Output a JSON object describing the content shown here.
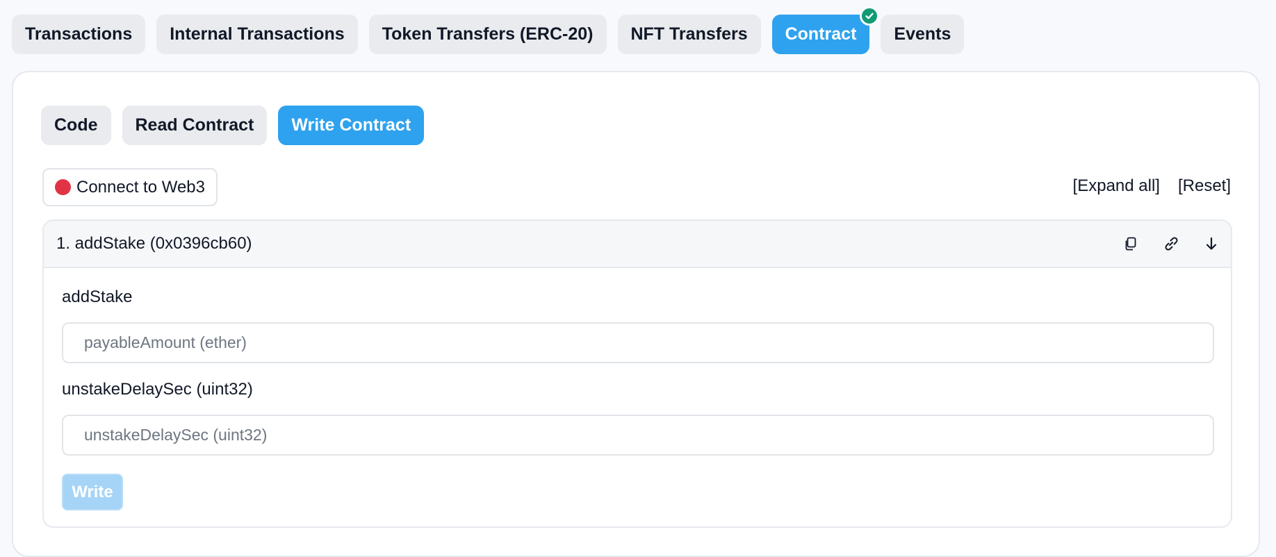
{
  "top_tabs": {
    "transactions": "Transactions",
    "internal": "Internal Transactions",
    "token_transfers": "Token Transfers (ERC-20)",
    "nft_transfers": "NFT Transfers",
    "contract": "Contract",
    "events": "Events"
  },
  "sub_tabs": {
    "code": "Code",
    "read": "Read Contract",
    "write": "Write Contract"
  },
  "connect": {
    "label": "Connect to Web3"
  },
  "actions": {
    "expand_all": "[Expand all]",
    "reset": "[Reset]"
  },
  "method": {
    "title": "1. addStake (0x0396cb60)",
    "field1_label": "addStake",
    "field1_placeholder": "payableAmount (ether)",
    "field2_label": "unstakeDelaySec (uint32)",
    "field2_placeholder": "unstakeDelaySec (uint32)",
    "write_label": "Write"
  },
  "colors": {
    "active_tab": "#2ea2ee",
    "verified_badge": "#129a74",
    "connect_dot": "#e03445",
    "write_disabled": "#a5d4f7"
  },
  "icons": [
    "check-icon",
    "copy-icon",
    "link-icon",
    "arrow-down-icon"
  ]
}
